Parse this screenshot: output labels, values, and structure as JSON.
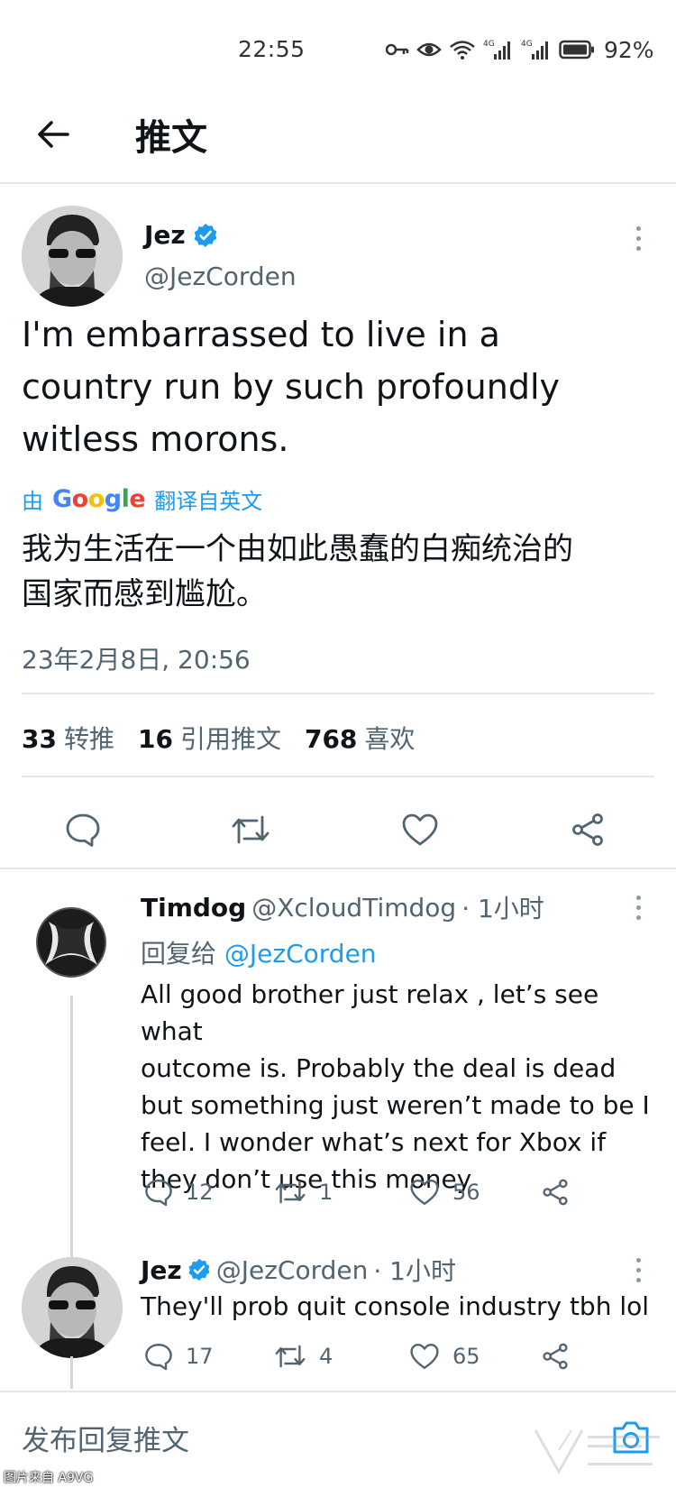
{
  "status_bar": {
    "time": "22:55",
    "battery_percent": "92%",
    "icons": [
      "key-icon",
      "eye-icon",
      "wifi-icon",
      "signal-4g-icon",
      "signal-4g-icon",
      "battery-icon"
    ]
  },
  "header": {
    "title": "推文",
    "back_icon": "arrow-left-icon"
  },
  "main_tweet": {
    "author_name": "Jez",
    "author_handle": "@JezCorden",
    "verified": true,
    "text_lines": [
      "I'm embarrassed to live in a",
      "country run by such profoundly",
      "witless morons."
    ],
    "translate_prefix": "由",
    "translate_brand": "Google",
    "translate_suffix": "翻译自英文",
    "translated_lines": [
      "我为生活在一个由如此愚蠢的白痴统治的",
      "国家而感到尴尬。"
    ],
    "timestamp": "23年2月8日, 20:56",
    "stats": {
      "retweets_count": "33",
      "retweets_label": "转推",
      "quotes_count": "16",
      "quotes_label": "引用推文",
      "likes_count": "768",
      "likes_label": "喜欢"
    }
  },
  "replies": [
    {
      "author_name": "Timdog",
      "author_handle": "@XcloudTimdog",
      "time": "· 1小时",
      "reply_to_prefix": "回复给",
      "reply_to_handle": "@JezCorden",
      "text_lines": [
        "All good brother just relax , let’s see what",
        "outcome is.   Probably the deal is dead",
        "but something just weren’t made to be I",
        "feel.  I wonder what’s next for Xbox if",
        "they don’t use this money"
      ],
      "replies_count": "12",
      "retweets_count": "1",
      "likes_count": "56"
    },
    {
      "author_name": "Jez",
      "author_handle": "@JezCorden",
      "time": "· 1小时",
      "verified": true,
      "text_lines": [
        "They'll prob quit console industry tbh lol"
      ],
      "replies_count": "17",
      "retweets_count": "4",
      "likes_count": "65"
    }
  ],
  "composer": {
    "placeholder": "发布回复推文"
  },
  "watermark": {
    "caption": "图片来自 A9VG"
  },
  "colors": {
    "accent": "#1d9bf0",
    "text": "#0f1419",
    "secondary": "#536471",
    "divider": "#e6e6e6"
  }
}
